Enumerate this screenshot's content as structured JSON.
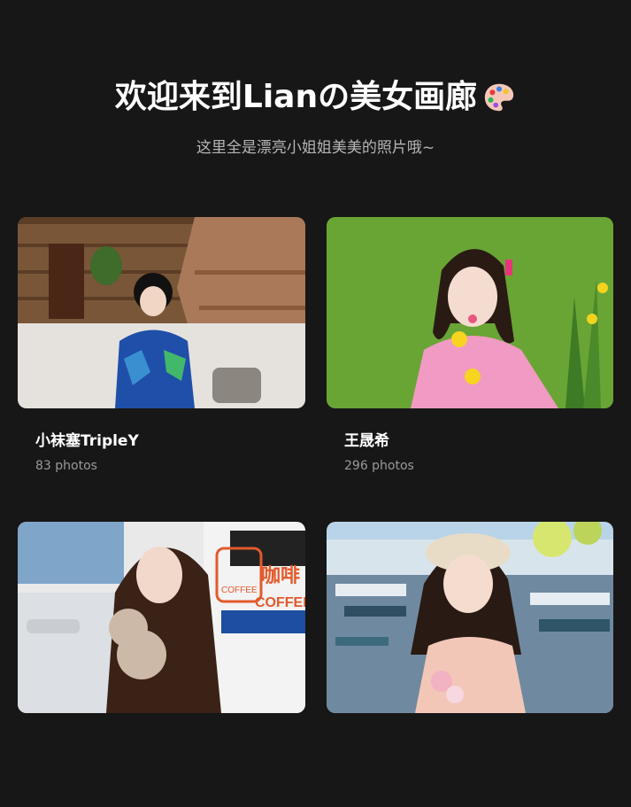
{
  "header": {
    "title": "欢迎来到Lianの美女画廊",
    "subtitle": "这里全是漂亮小姐姐美美的照片哦~"
  },
  "albums": [
    {
      "name": "小袜塞TripleY",
      "count": "83 photos"
    },
    {
      "name": "王晟希",
      "count": "296 photos"
    },
    {
      "name": "",
      "count": ""
    },
    {
      "name": "",
      "count": ""
    }
  ],
  "signage": {
    "coffee_cn": "咖啡",
    "coffee_en": "COFFEE"
  }
}
